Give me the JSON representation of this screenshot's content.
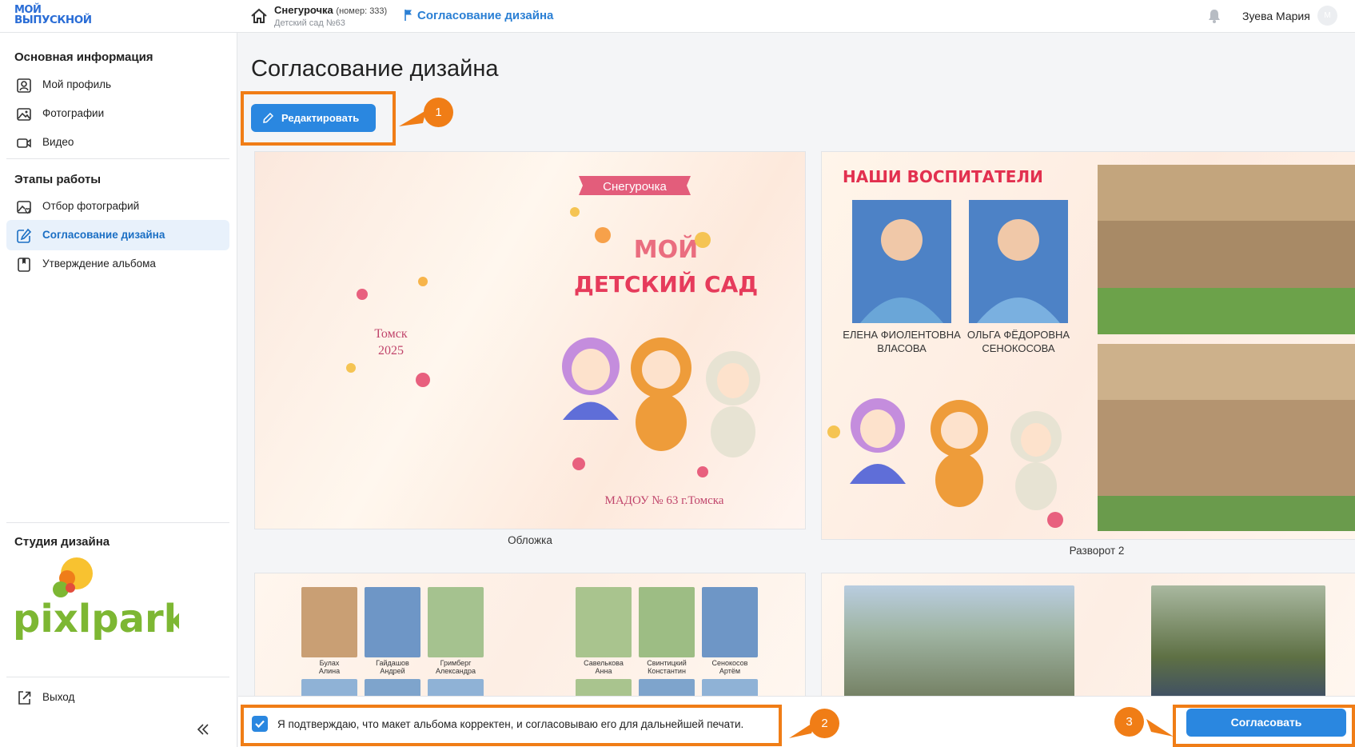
{
  "header": {
    "logo_line1": "МОЙ",
    "logo_line2": "ВЫПУСКНОЙ",
    "project_name": "Снегурочка",
    "project_number": "(номер: 333)",
    "project_subtitle": "Детский сад №63",
    "breadcrumb_current": "Согласование дизайна",
    "user_name": "Зуева Мария",
    "avatar_initial": "М"
  },
  "sidebar": {
    "section1_title": "Основная информация",
    "section1_items": [
      {
        "label": "Мой профиль",
        "icon": "profile-icon"
      },
      {
        "label": "Фотографии",
        "icon": "photo-icon"
      },
      {
        "label": "Видео",
        "icon": "video-icon"
      }
    ],
    "section2_title": "Этапы работы",
    "section2_items": [
      {
        "label": "Отбор фотографий",
        "icon": "photo-select-icon"
      },
      {
        "label": "Согласование дизайна",
        "icon": "edit-icon",
        "active": true
      },
      {
        "label": "Утверждение альбома",
        "icon": "bookmark-icon"
      }
    ],
    "studio_title": "Студия дизайна",
    "studio_logo": "pixlpark",
    "exit_label": "Выход"
  },
  "main": {
    "page_title": "Согласование дизайна",
    "edit_button": "Редактировать",
    "cards": [
      {
        "caption": "Обложка"
      },
      {
        "caption": "Разворот 2"
      },
      {
        "caption": ""
      },
      {
        "caption": ""
      }
    ],
    "cover": {
      "banner": "Снегурочка",
      "title_line1": "МОЙ",
      "title_line2": "ДЕТСКИЙ САД",
      "city": "Томск",
      "year": "2025",
      "school": "МАДОУ № 63 г.Томска"
    },
    "spread2": {
      "heading": "НАШИ ВОСПИТАТЕЛИ",
      "teacher1_line1": "ЕЛЕНА ФИОЛЕНТОВНА",
      "teacher1_line2": "ВЛАСОВА",
      "teacher2_line1": "ОЛЬГА ФЁДОРОВНА",
      "teacher2_line2": "СЕНОКОСОВА"
    },
    "spread3": {
      "names": [
        {
          "l1": "Булах",
          "l2": "Алина"
        },
        {
          "l1": "Гайдашов",
          "l2": "Андрей"
        },
        {
          "l1": "Гримберг",
          "l2": "Александра"
        },
        {
          "l1": "Савелькова",
          "l2": "Анна"
        },
        {
          "l1": "Свинтицкий",
          "l2": "Константин"
        },
        {
          "l1": "Сенокосов",
          "l2": "Артём"
        }
      ]
    }
  },
  "footer": {
    "confirm_text": "Я подтверждаю, что макет альбома корректен, и согласовываю его для дальнейшей печати.",
    "confirm_checked": true,
    "approve_button": "Согласовать"
  },
  "callouts": [
    "1",
    "2",
    "3"
  ],
  "colors": {
    "accent": "#2a87e0",
    "highlight": "#f07d16",
    "active_bg": "#e8f1fb"
  }
}
